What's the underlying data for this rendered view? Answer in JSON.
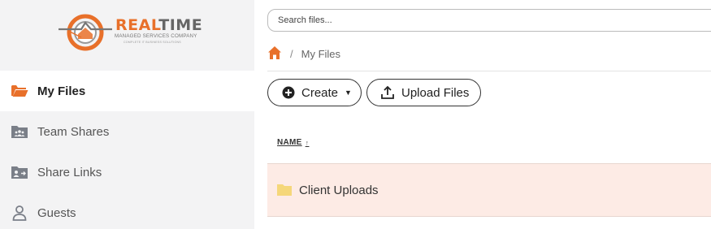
{
  "logo": {
    "title_part1": "REAL",
    "title_part2": "TIME",
    "subtitle": "MANAGED SERVICES COMPANY",
    "tagline": "COMPLETE IT BUSINESS SOLUTIONS"
  },
  "sidebar": {
    "items": [
      {
        "label": "My Files",
        "icon": "folder-open-icon",
        "active": true
      },
      {
        "label": "Team Shares",
        "icon": "team-folder-icon",
        "active": false
      },
      {
        "label": "Share Links",
        "icon": "share-folder-icon",
        "active": false
      },
      {
        "label": "Guests",
        "icon": "user-icon",
        "active": false
      }
    ]
  },
  "search": {
    "placeholder": "Search files...",
    "value": ""
  },
  "breadcrumb": {
    "home_icon": "home-icon",
    "separator": "/",
    "current": "My Files"
  },
  "toolbar": {
    "create_label": "Create",
    "upload_label": "Upload Files"
  },
  "table": {
    "columns": [
      {
        "label": "NAME",
        "sort": "↑"
      }
    ],
    "rows": [
      {
        "name": "Client Uploads",
        "type": "folder",
        "highlighted": true
      }
    ]
  },
  "colors": {
    "accent": "#e8702a",
    "sidebar_bg": "#f3f3f4",
    "row_highlight": "#fdebe5",
    "folder": "#f5d77a"
  }
}
